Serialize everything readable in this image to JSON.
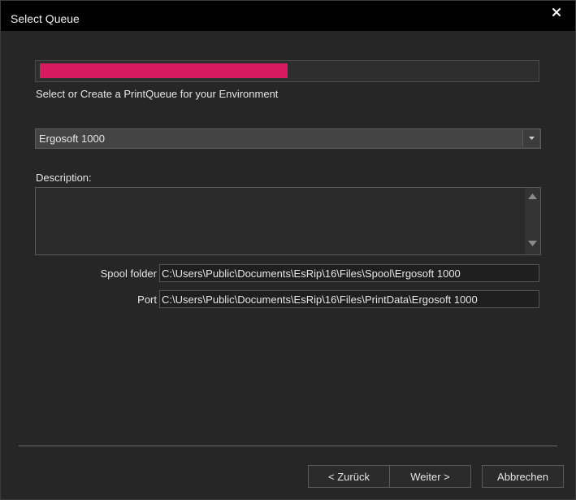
{
  "window": {
    "title": "Select Queue",
    "close_icon": "close-icon"
  },
  "progress": {
    "value": 0.5,
    "color": "#d81b60"
  },
  "instruction": "Select or Create a PrintQueue for your Environment",
  "queue_select": {
    "value": "Ergosoft 1000"
  },
  "description": {
    "label": "Description:",
    "value": ""
  },
  "spool_folder": {
    "label": "Spool folder",
    "value": "C:\\Users\\Public\\Documents\\EsRip\\16\\Files\\Spool\\Ergosoft 1000"
  },
  "port": {
    "label": "Port",
    "value": "C:\\Users\\Public\\Documents\\EsRip\\16\\Files\\PrintData\\Ergosoft 1000"
  },
  "buttons": {
    "back": "< Zurück",
    "next": "Weiter >",
    "cancel": "Abbrechen"
  }
}
